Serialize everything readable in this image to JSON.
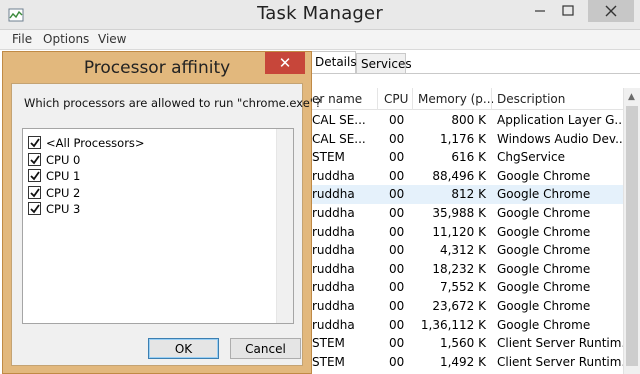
{
  "window": {
    "title": "Task Manager",
    "menu": [
      "File",
      "Options",
      "View"
    ],
    "tabs": [
      "Details",
      "Services"
    ],
    "columns": [
      "er name",
      "CPU",
      "Memory (p...",
      "Description"
    ],
    "rows": [
      {
        "user": "CAL SE...",
        "cpu": "00",
        "mem": "800 K",
        "desc": "Application Layer G..."
      },
      {
        "user": "CAL SE...",
        "cpu": "00",
        "mem": "1,176 K",
        "desc": "Windows Audio Dev..."
      },
      {
        "user": "STEM",
        "cpu": "00",
        "mem": "616 K",
        "desc": "ChgService"
      },
      {
        "user": "ruddha",
        "cpu": "00",
        "mem": "88,496 K",
        "desc": "Google Chrome"
      },
      {
        "user": "ruddha",
        "cpu": "00",
        "mem": "812 K",
        "desc": "Google Chrome",
        "selected": true
      },
      {
        "user": "ruddha",
        "cpu": "00",
        "mem": "35,988 K",
        "desc": "Google Chrome"
      },
      {
        "user": "ruddha",
        "cpu": "00",
        "mem": "11,120 K",
        "desc": "Google Chrome"
      },
      {
        "user": "ruddha",
        "cpu": "00",
        "mem": "4,312 K",
        "desc": "Google Chrome"
      },
      {
        "user": "ruddha",
        "cpu": "00",
        "mem": "18,232 K",
        "desc": "Google Chrome"
      },
      {
        "user": "ruddha",
        "cpu": "00",
        "mem": "7,552 K",
        "desc": "Google Chrome"
      },
      {
        "user": "ruddha",
        "cpu": "00",
        "mem": "23,672 K",
        "desc": "Google Chrome"
      },
      {
        "user": "ruddha",
        "cpu": "00",
        "mem": "1,36,112 K",
        "desc": "Google Chrome"
      },
      {
        "user": "STEM",
        "cpu": "00",
        "mem": "1,560 K",
        "desc": "Client Server Runtim..."
      },
      {
        "user": "STEM",
        "cpu": "00",
        "mem": "1,492 K",
        "desc": "Client Server Runtim..."
      }
    ]
  },
  "dialog": {
    "title": "Processor affinity",
    "close_glyph": "✕",
    "question": "Which processors are allowed to run \"chrome.exe\"?",
    "processors": [
      {
        "label": "<All Processors>",
        "checked": true
      },
      {
        "label": "CPU 0",
        "checked": true
      },
      {
        "label": "CPU 1",
        "checked": true
      },
      {
        "label": "CPU 2",
        "checked": true
      },
      {
        "label": "CPU 3",
        "checked": true
      }
    ],
    "ok_label": "OK",
    "cancel_label": "Cancel"
  },
  "colors": {
    "dialog_frame": "#e2b87d",
    "close_button": "#c7463a",
    "selected_row": "#e5f1fb"
  }
}
